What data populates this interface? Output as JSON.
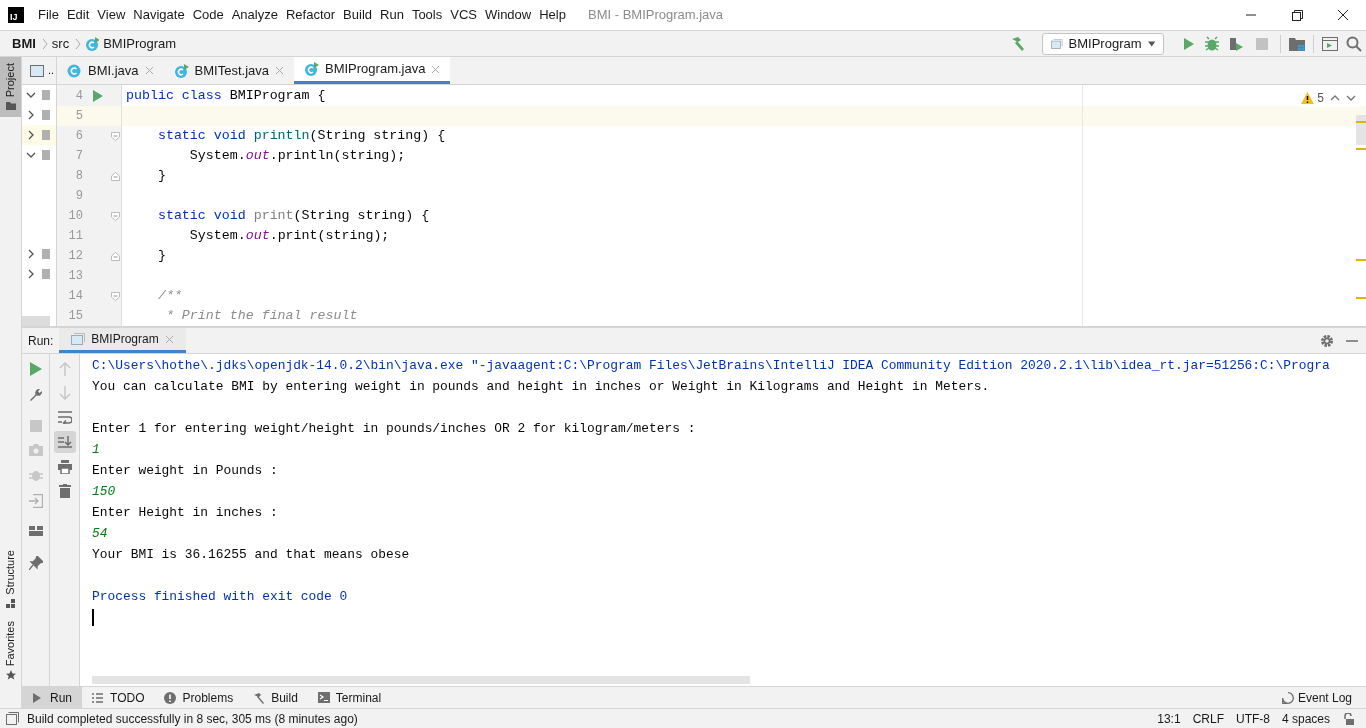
{
  "menu_bar": {
    "logo_text": "IJ",
    "items": [
      "File",
      "Edit",
      "View",
      "Navigate",
      "Code",
      "Analyze",
      "Refactor",
      "Build",
      "Run",
      "Tools",
      "VCS",
      "Window",
      "Help"
    ],
    "title": "BMI - BMIProgram.java"
  },
  "breadcrumbs": [
    {
      "label": "BMI",
      "kind": "project"
    },
    {
      "label": "src",
      "kind": "folder"
    },
    {
      "label": "BMIProgram",
      "kind": "class"
    }
  ],
  "run_config": "BMIProgram",
  "side_stripe": [
    {
      "label": "Project",
      "selected": true
    },
    {
      "label": "Structure",
      "selected": false
    },
    {
      "label": "Favorites",
      "selected": false
    }
  ],
  "project_panel": {
    "header": "..",
    "rows": [
      {
        "expanded": true,
        "selected": false
      },
      {
        "expanded": false,
        "selected": false
      },
      {
        "expanded": false,
        "selected": true
      },
      {
        "expanded": true,
        "selected": false
      }
    ],
    "lower_rows": [
      {
        "expanded": false,
        "selected": false
      },
      {
        "expanded": false,
        "selected": false
      }
    ]
  },
  "editor_tabs": [
    {
      "label": "BMI.java",
      "kind": "class",
      "selected": false
    },
    {
      "label": "BMITest.java",
      "kind": "runnable",
      "selected": false
    },
    {
      "label": "BMIProgram.java",
      "kind": "runnable",
      "selected": true
    }
  ],
  "warnings": "5",
  "code_lines": [
    {
      "number": "4",
      "current": false,
      "run_marker": true,
      "tokens": [
        {
          "kind": "keyword",
          "text": "public class "
        },
        {
          "kind": "plain",
          "text": "BMIProgram {"
        }
      ]
    },
    {
      "number": "5",
      "current": true
    },
    {
      "number": "6",
      "current": false,
      "fold_open": true,
      "tokens": [
        {
          "kind": "keyword",
          "text": "    static void "
        },
        {
          "kind": "method",
          "text": "println"
        },
        {
          "kind": "plain",
          "text": "(String string) {"
        }
      ]
    },
    {
      "number": "7",
      "current": false,
      "tokens": [
        {
          "kind": "plain",
          "text": "        System."
        },
        {
          "kind": "field",
          "text": "out"
        },
        {
          "kind": "plain",
          "text": ".println(string);"
        }
      ]
    },
    {
      "number": "8",
      "current": false,
      "fold_close": true,
      "tokens": [
        {
          "kind": "plain",
          "text": "    }"
        }
      ]
    },
    {
      "number": "9",
      "current": false
    },
    {
      "number": "10",
      "current": false,
      "fold_open": true,
      "tokens": [
        {
          "kind": "keyword",
          "text": "    static void "
        },
        {
          "kind": "unused",
          "text": "print"
        },
        {
          "kind": "plain",
          "text": "(String string) {"
        }
      ]
    },
    {
      "number": "11",
      "current": false,
      "tokens": [
        {
          "kind": "plain",
          "text": "        System."
        },
        {
          "kind": "field",
          "text": "out"
        },
        {
          "kind": "plain",
          "text": ".print(string);"
        }
      ]
    },
    {
      "number": "12",
      "current": false,
      "fold_close": true,
      "tokens": [
        {
          "kind": "plain",
          "text": "    }"
        }
      ]
    },
    {
      "number": "13",
      "current": false
    },
    {
      "number": "14",
      "current": false,
      "fold_open": true,
      "tokens": [
        {
          "kind": "comment",
          "text": "    /**"
        }
      ]
    },
    {
      "number": "15",
      "current": false,
      "tokens": [
        {
          "kind": "comment",
          "text": "     * Print the final result"
        }
      ]
    }
  ],
  "run_panel": {
    "label": "Run:",
    "tabs": [
      {
        "label": "BMIProgram",
        "selected": true
      }
    ],
    "console": [
      {
        "kind": "system",
        "text": "C:\\Users\\hothe\\.jdks\\openjdk-14.0.2\\bin\\java.exe \"-javaagent:C:\\Program Files\\JetBrains\\IntelliJ IDEA Community Edition 2020.2.1\\lib\\idea_rt.jar=51256:C:\\Progra"
      },
      {
        "kind": "output",
        "text": "You can calculate BMI by entering weight in pounds and height in inches or Weight in Kilograms and Height in Meters."
      },
      {
        "kind": "blank"
      },
      {
        "kind": "output",
        "text": "Enter 1 for entering weight/height in pounds/inches OR 2 for kilogram/meters :"
      },
      {
        "kind": "input",
        "text": "1"
      },
      {
        "kind": "output",
        "text": "Enter weight in Pounds :"
      },
      {
        "kind": "input",
        "text": "150"
      },
      {
        "kind": "output",
        "text": "Enter Height in inches :"
      },
      {
        "kind": "input",
        "text": "54"
      },
      {
        "kind": "output",
        "text": "Your BMI is 36.16255 and that means obese"
      },
      {
        "kind": "blank"
      },
      {
        "kind": "system",
        "text": "Process finished with exit code 0"
      },
      {
        "kind": "caret"
      }
    ]
  },
  "bottom_tabs": [
    {
      "label": "Run",
      "kind": "run",
      "selected": true
    },
    {
      "label": "TODO",
      "kind": "list",
      "selected": false
    },
    {
      "label": "Problems",
      "kind": "problems",
      "selected": false
    },
    {
      "label": "Build",
      "kind": "build",
      "selected": false
    },
    {
      "label": "Terminal",
      "kind": "terminal",
      "selected": false
    }
  ],
  "event_log": "Event Log",
  "status_bar": {
    "message": "Build completed successfully in 8 sec, 305 ms (8 minutes ago)",
    "items": [
      "13:1",
      "CRLF",
      "UTF-8",
      "4 spaces"
    ]
  }
}
